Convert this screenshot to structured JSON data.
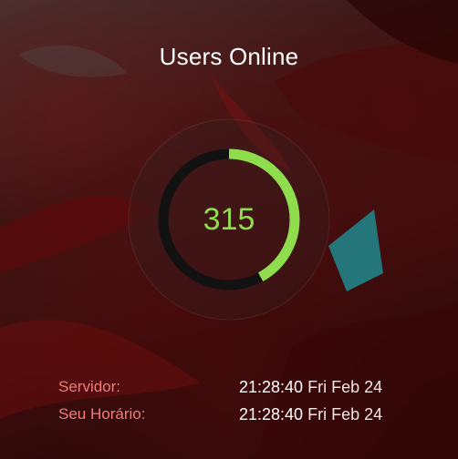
{
  "widget": {
    "title": "Users Online",
    "users_online": 315,
    "gauge_fraction": 0.42,
    "accent_color": "#8fdd4c",
    "track_color": "#121212"
  },
  "times": [
    {
      "label": "Servidor:",
      "clock": "21:28:40",
      "date": "Fri Feb 24"
    },
    {
      "label": "Seu Horário:",
      "clock": "21:28:40",
      "date": "Fri Feb 24"
    }
  ]
}
